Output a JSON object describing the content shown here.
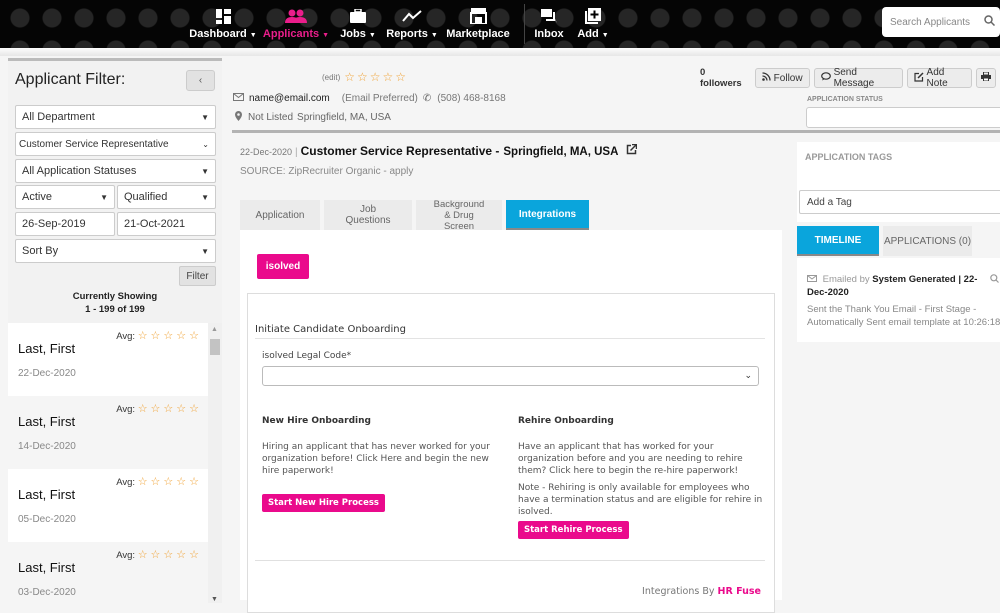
{
  "nav": {
    "items": [
      {
        "label": "Dashboard",
        "icon": "dashboard-icon",
        "caret": true,
        "active": false
      },
      {
        "label": "Applicants",
        "icon": "users-icon",
        "caret": true,
        "active": true
      },
      {
        "label": "Jobs",
        "icon": "briefcase-icon",
        "caret": true,
        "active": false
      },
      {
        "label": "Reports",
        "icon": "line-chart-icon",
        "caret": true,
        "active": false
      },
      {
        "label": "Marketplace",
        "icon": "store-icon",
        "caret": false,
        "active": false
      },
      {
        "label": "Inbox",
        "icon": "chat-icon",
        "caret": false,
        "active": false
      },
      {
        "label": "Add",
        "icon": "add-square-icon",
        "caret": true,
        "active": false
      }
    ],
    "search_placeholder": "Search Applicants",
    "accent": "#ea1e8b"
  },
  "filter": {
    "title": "Applicant Filter:",
    "collapse_label": "‹",
    "department": "All Department",
    "job": "Customer Service Representative",
    "status": "All Application Statuses",
    "active": "Active",
    "qualified": "Qualified",
    "date_from": "26-Sep-2019",
    "date_to": "21-Oct-2021",
    "sort": "Sort By",
    "filter_button": "Filter",
    "showing_label": "Currently Showing",
    "showing_range": "1 - 199 of 199"
  },
  "applicants": [
    {
      "name": "Last, First",
      "date": "22-Dec-2020",
      "avg_label": "Avg:",
      "rating": 0
    },
    {
      "name": "Last, First",
      "date": "14-Dec-2020",
      "avg_label": "Avg:",
      "rating": 0
    },
    {
      "name": "Last, First",
      "date": "05-Dec-2020",
      "avg_label": "Avg:",
      "rating": 0
    },
    {
      "name": "Last, First",
      "date": "03-Dec-2020",
      "avg_label": "Avg:",
      "rating": 0
    }
  ],
  "profile": {
    "edit_label": "(edit)",
    "rating": 0,
    "email": "name@email.com",
    "email_pref": "(Email Preferred)",
    "phone": "(508) 468-8168",
    "address_status": "Not Listed",
    "location": "Springfield, MA, USA"
  },
  "job": {
    "date": "22-Dec-2020",
    "separator": "|",
    "title": "Customer Service Representative -",
    "location": "Springfield, MA, USA",
    "source_label": "SOURCE:",
    "source_value": "ZipRecruiter Organic - apply"
  },
  "tabs": [
    {
      "label": "Application",
      "active": false
    },
    {
      "label": "Job Questions",
      "active": false
    },
    {
      "label": "Background & Drug Screen",
      "active": false
    },
    {
      "label": "Integrations",
      "active": true
    }
  ],
  "integrations": {
    "provider_button": "isolved",
    "section_title": "Initiate Candidate Onboarding",
    "legal_code_label": "isolved Legal Code*",
    "legal_code_value": "",
    "new_hire": {
      "title": "New Hire Onboarding",
      "description": "Hiring an applicant that has never worked for your organization before! Click Here and begin the new hire paperwork!",
      "button": "Start New Hire Process"
    },
    "rehire": {
      "title": "Rehire Onboarding",
      "description": "Have an applicant that has worked for your organization before and you are needing to rehire them? Click here to begin the re-hire paperwork!",
      "note": "Note - Rehiring is only available for employees who have a termination status and are eligible for rehire in isolved.",
      "button": "Start Rehire Process"
    },
    "powered_by": "Integrations By",
    "powered_brand": "HR Fuse"
  },
  "actions": {
    "followers": "0 followers",
    "follow": "Follow",
    "send_message": "Send Message",
    "add_note": "Add Note",
    "application_status_label": "APPLICATION STATUS",
    "application_status_value": ""
  },
  "tags": {
    "label": "APPLICATION TAGS",
    "placeholder": "Add a Tag"
  },
  "right_tabs": [
    {
      "label": "TIMELINE",
      "active": true
    },
    {
      "label": "APPLICATIONS (0)",
      "active": false
    }
  ],
  "timeline": {
    "action": "Emailed by",
    "actor": "System Generated",
    "date": "| 22-Dec-2020",
    "body": "Sent the Thank You Email - First Stage - Automatically Sent email template at 10:26:18"
  },
  "colors": {
    "brand_pink": "#ea0a8c",
    "tab_blue": "#0aa5dc",
    "star": "#f0a030"
  }
}
